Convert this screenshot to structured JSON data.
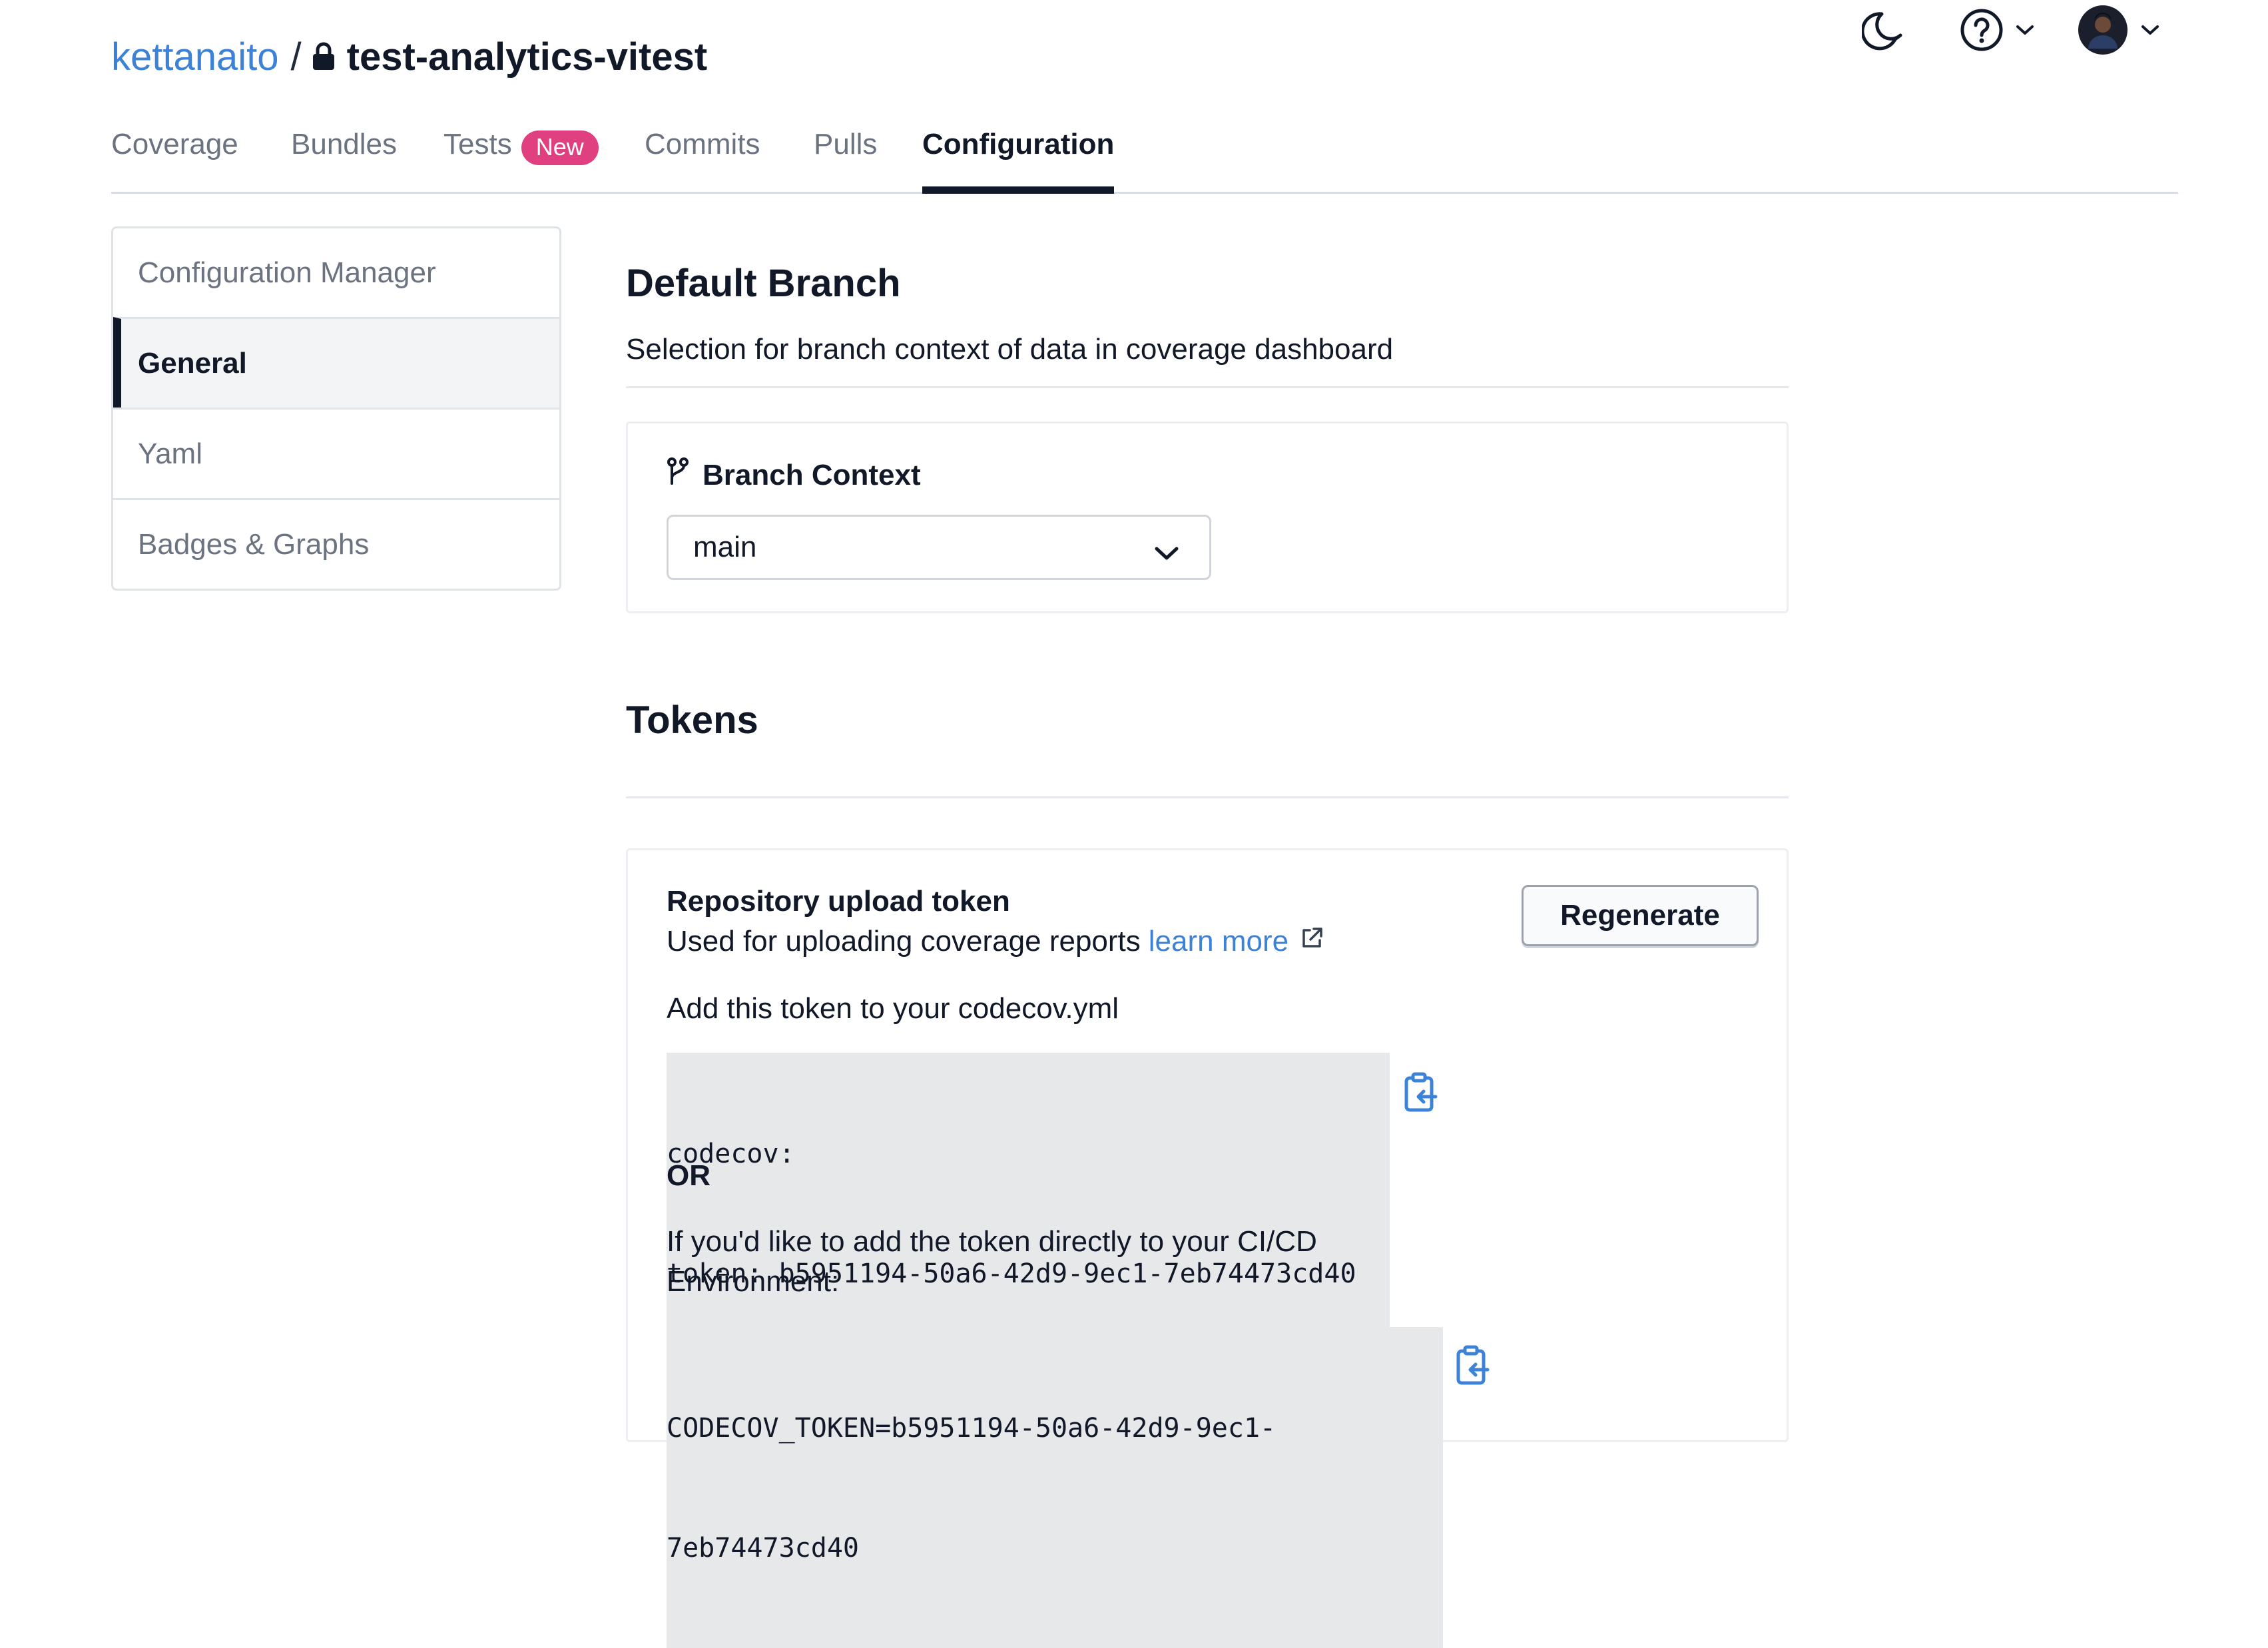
{
  "header": {
    "owner": "kettanaito",
    "separator": "/",
    "repo": "test-analytics-vitest",
    "icons": {
      "lock": "lock-icon",
      "theme": "moon-icon",
      "help": "help-circle-icon",
      "avatar": "user-avatar"
    }
  },
  "tabs": [
    {
      "label": "Coverage"
    },
    {
      "label": "Bundles"
    },
    {
      "label": "Tests",
      "badge": "New"
    },
    {
      "label": "Commits"
    },
    {
      "label": "Pulls"
    },
    {
      "label": "Configuration",
      "active": true
    }
  ],
  "sidebar": {
    "items": [
      {
        "label": "Configuration Manager"
      },
      {
        "label": "General",
        "active": true
      },
      {
        "label": "Yaml"
      },
      {
        "label": "Badges & Graphs"
      }
    ]
  },
  "default_branch": {
    "title": "Default Branch",
    "description": "Selection for branch context of data in coverage dashboard",
    "branch_context_label": "Branch Context",
    "selected_branch": "main"
  },
  "tokens": {
    "title": "Tokens",
    "upload_token": {
      "title": "Repository upload token",
      "subtitle": "Used for uploading coverage reports",
      "learn_more": "learn more",
      "regenerate_label": "Regenerate",
      "yml_instruction": "Add this token to your codecov.yml",
      "yml_line1": "codecov:",
      "yml_line2": "token: b5951194-50a6-42d9-9ec1-7eb74473cd40",
      "or_label": "OR",
      "env_instruction_line1": "If you'd like to add the token directly to your CI/CD",
      "env_instruction_line2": "Environment:",
      "env_line1": "CODECOV_TOKEN=b5951194-50a6-42d9-9ec1-",
      "env_line2": "7eb74473cd40"
    }
  }
}
